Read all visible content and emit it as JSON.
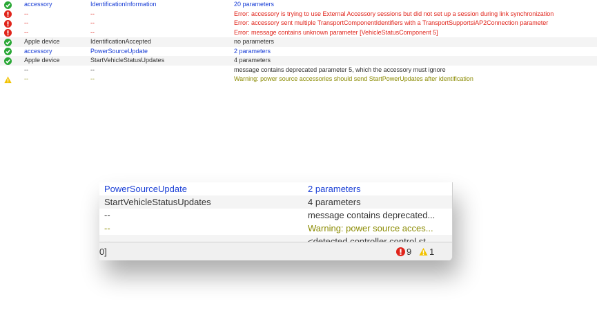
{
  "colors": {
    "ok": "#2aa836",
    "error": "#e0241b",
    "warning": "#f2c200",
    "link_blue": "#1a3fd6",
    "warning_text": "#8a8a00"
  },
  "log_rows": [
    {
      "icon": "check-icon",
      "source": "accessory",
      "message": "IdentificationInformation",
      "detail": "20 parameters"
    },
    {
      "icon": "error-icon",
      "source": "--",
      "message": "--",
      "detail": "Error: accessory is trying to use External Accessory sessions but did not set up a session during link synchronization"
    },
    {
      "icon": "error-icon",
      "source": "--",
      "message": "--",
      "detail": "Error: accessory sent multiple TransportComponentIdentifiers with a TransportSupportsiAP2Connection parameter"
    },
    {
      "icon": "error-icon",
      "source": "--",
      "message": "--",
      "detail": "Error: message contains unknown parameter [VehicleStatusComponent 5]"
    },
    {
      "icon": "check-icon",
      "source": "Apple device",
      "message": "IdentificationAccepted",
      "detail": "no parameters"
    },
    {
      "icon": "check-icon",
      "source": "accessory",
      "message": "PowerSourceUpdate",
      "detail": "2 parameters"
    },
    {
      "icon": "check-icon",
      "source": "Apple device",
      "message": "StartVehicleStatusUpdates",
      "detail": "4 parameters"
    },
    {
      "icon": "",
      "source": "--",
      "message": "--",
      "detail": "message contains deprecated parameter 5, which the accessory must ignore"
    },
    {
      "icon": "warning-icon",
      "source": "--",
      "message": "--",
      "detail": "Warning: power source accessories should send StartPowerUpdates after identification"
    }
  ],
  "zoom": {
    "rows": [
      {
        "message": "PowerSourceUpdate",
        "detail": "2 parameters"
      },
      {
        "message": "StartVehicleStatusUpdates",
        "detail": "4 parameters"
      },
      {
        "message": "--",
        "detail": "message contains deprecated..."
      },
      {
        "message": "--",
        "detail": "Warning: power source acces..."
      },
      {
        "message": "--",
        "detail": "<detected controller control st"
      }
    ],
    "status": {
      "bracket": "0]",
      "error_count": "9",
      "warning_count": "1"
    }
  }
}
